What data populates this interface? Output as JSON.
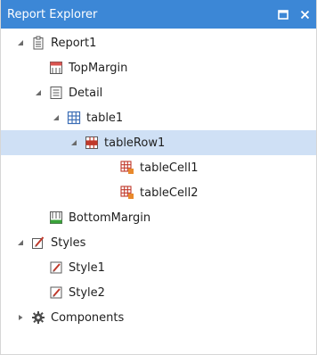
{
  "panel": {
    "title": "Report Explorer",
    "restore_button_icon": "restore-window-icon",
    "close_button_icon": "close-x-icon"
  },
  "tree": {
    "nodes": [
      {
        "label": "Report1",
        "icon": "report-icon",
        "expander": "expanded"
      },
      {
        "label": "TopMargin",
        "icon": "top-margin-icon",
        "expander": "none"
      },
      {
        "label": "Detail",
        "icon": "detail-band-icon",
        "expander": "expanded"
      },
      {
        "label": "table1",
        "icon": "table-icon",
        "expander": "expanded"
      },
      {
        "label": "tableRow1",
        "icon": "table-row-icon",
        "expander": "expanded",
        "selected": true
      },
      {
        "label": "tableCell1",
        "icon": "table-cell-icon",
        "expander": "none"
      },
      {
        "label": "tableCell2",
        "icon": "table-cell-icon",
        "expander": "none"
      },
      {
        "label": "BottomMargin",
        "icon": "bottom-margin-icon",
        "expander": "none"
      },
      {
        "label": "Styles",
        "icon": "styles-icon",
        "expander": "expanded"
      },
      {
        "label": "Style1",
        "icon": "style-icon",
        "expander": "none"
      },
      {
        "label": "Style2",
        "icon": "style-icon",
        "expander": "none"
      },
      {
        "label": "Components",
        "icon": "gear-icon",
        "expander": "collapsed"
      }
    ]
  },
  "colors": {
    "title_bar": "#3c87d6",
    "selection": "#cfe0f5",
    "margin_red": "#d9534f",
    "table_blue": "#3d6fb6",
    "table_row_red": "#c0392b",
    "cell_orange": "#e8892c",
    "bottom_green": "#3aa33a"
  }
}
